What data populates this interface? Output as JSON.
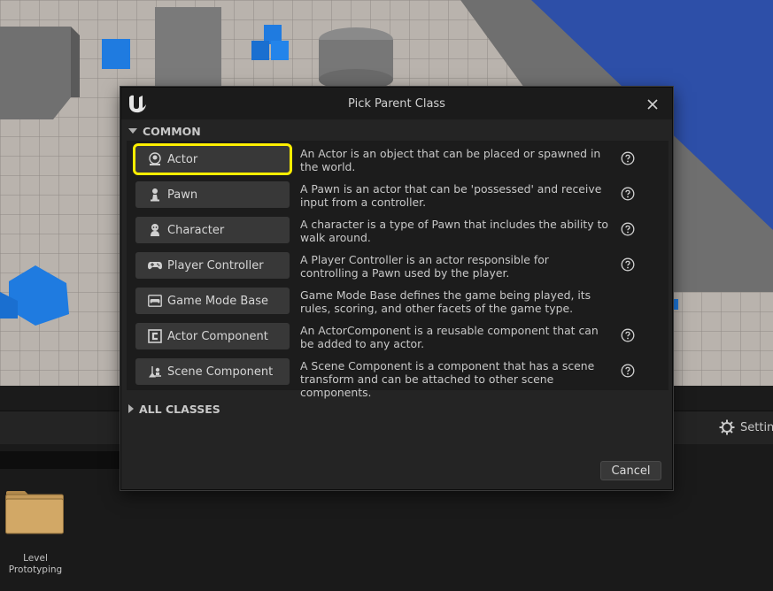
{
  "dialog": {
    "title": "Pick Parent Class",
    "common_header": "COMMON",
    "all_classes_header": "ALL CLASSES",
    "cancel_label": "Cancel",
    "selected_class": "Actor",
    "highlight_color": "#ffee00",
    "classes": [
      {
        "label": "Actor",
        "icon": "actor-icon",
        "description": "An Actor is an object that can be placed or spawned in the world.",
        "has_help": true
      },
      {
        "label": "Pawn",
        "icon": "pawn-icon",
        "description": "A Pawn is an actor that can be 'possessed' and receive input from a controller.",
        "has_help": true
      },
      {
        "label": "Character",
        "icon": "character-icon",
        "description": "A character is a type of Pawn that includes the ability to walk around.",
        "has_help": true
      },
      {
        "label": "Player Controller",
        "icon": "gamepad-icon",
        "description": "A Player Controller is an actor responsible for controlling a Pawn used by the player.",
        "has_help": true
      },
      {
        "label": "Game Mode Base",
        "icon": "game-mode-icon",
        "description": "Game Mode Base defines the game being played, its rules, scoring, and other facets of the game type.",
        "has_help": false
      },
      {
        "label": "Actor Component",
        "icon": "actor-component-icon",
        "description": "An ActorComponent is a reusable component that can be added to any actor.",
        "has_help": true
      },
      {
        "label": "Scene Component",
        "icon": "scene-component-icon",
        "description": "A Scene Component is a component that has a scene transform and can be attached to other scene components.",
        "has_help": true
      }
    ]
  },
  "editor": {
    "settings_label": "Settin",
    "folder_label": "Level Prototyping"
  }
}
